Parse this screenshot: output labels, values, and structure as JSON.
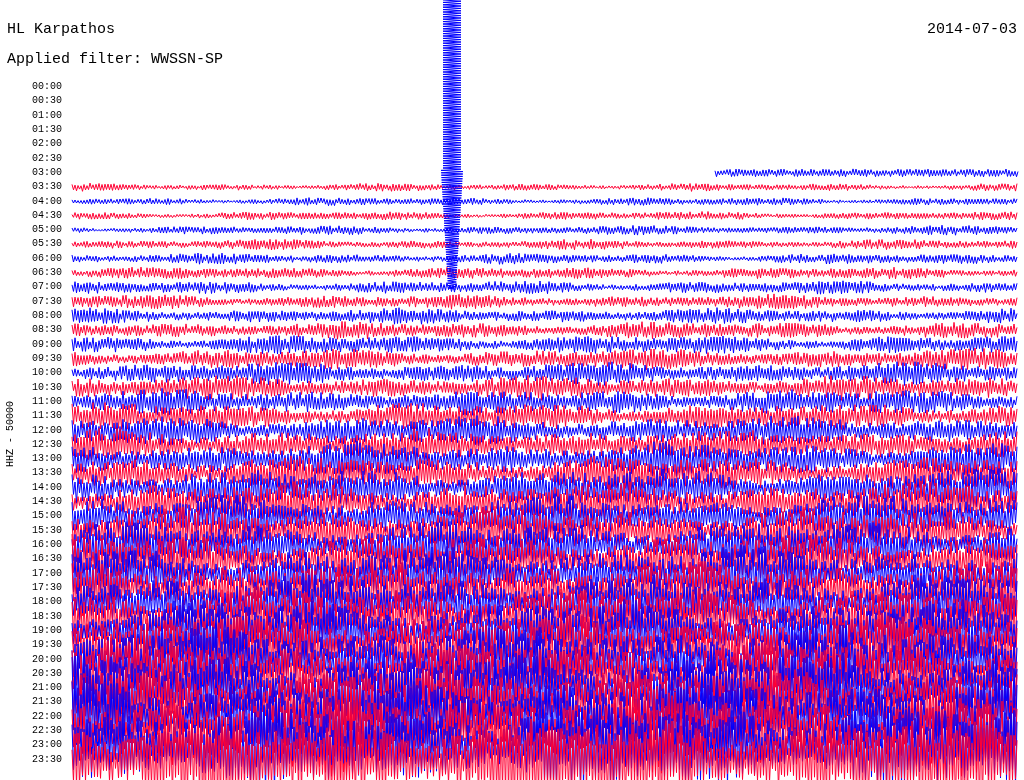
{
  "header": {
    "station": "HL Karpathos",
    "date": "2014-07-03",
    "filter": "Applied filter: WWSSN-SP"
  },
  "axis_label": "HHZ - 50000",
  "time_labels": [
    "00:00",
    "00:30",
    "01:00",
    "01:30",
    "02:00",
    "02:30",
    "03:00",
    "03:30",
    "04:00",
    "04:30",
    "05:00",
    "05:30",
    "06:00",
    "06:30",
    "07:00",
    "07:30",
    "08:00",
    "08:30",
    "09:00",
    "09:30",
    "10:00",
    "10:30",
    "11:00",
    "11:30",
    "12:00",
    "12:30",
    "13:00",
    "13:30",
    "14:00",
    "14:30",
    "15:00",
    "15:30",
    "16:00",
    "16:30",
    "17:00",
    "17:30",
    "18:00",
    "18:30",
    "19:00",
    "19:30",
    "20:00",
    "20:30",
    "21:00",
    "21:30",
    "22:00",
    "22:30",
    "23:00",
    "23:30"
  ]
}
